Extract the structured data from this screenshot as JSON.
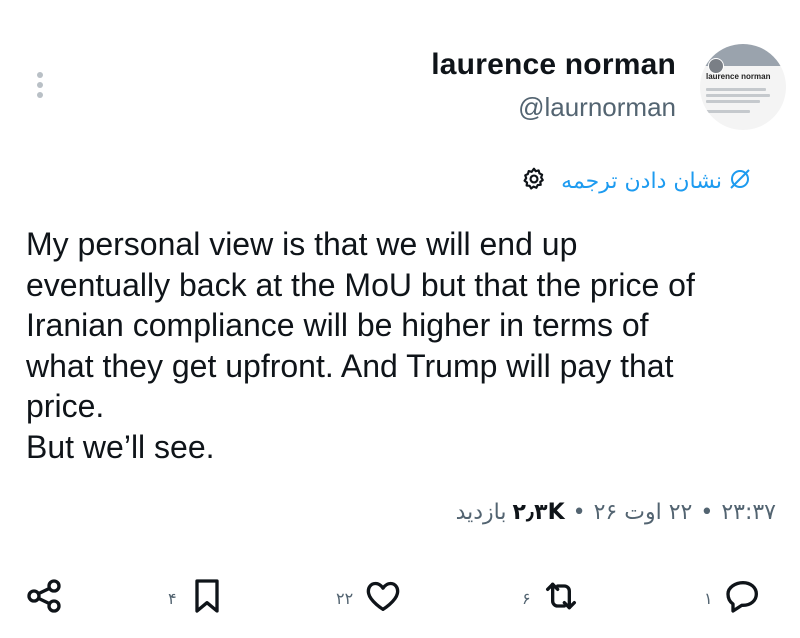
{
  "header": {
    "more_icon": "more-vertical-icon",
    "display_name": "laurence norman",
    "handle": "@laurnorman",
    "profile_card": {
      "name": "laurence norman",
      "bio": "In Europe for The Wall Street Journal, nuclear, EU, European foreign policy"
    }
  },
  "translate": {
    "label": "نشان دادن ترجمه",
    "globe_icon": "globe-slash-icon",
    "settings_icon": "gear-icon"
  },
  "tweet": {
    "lines": [
      "My personal view is that we will end up",
      "eventually back at the MoU but that the price of",
      "Iranian compliance will be higher in terms of",
      "what they get upfront. And Trump will pay that",
      "price.",
      "But we’ll see."
    ]
  },
  "meta": {
    "time": "۲۳:۳۷",
    "date": "۲۲ اوت ۲۶",
    "views_count": "۲٫۳K",
    "views_label": "بازدید",
    "separator": "•"
  },
  "actions": {
    "reply": {
      "icon": "reply-icon",
      "count": "۱"
    },
    "retweet": {
      "icon": "retweet-icon",
      "count": "۶"
    },
    "like": {
      "icon": "heart-icon",
      "count": "۲۲"
    },
    "bookmark": {
      "icon": "bookmark-icon",
      "count": "۴"
    },
    "share": {
      "icon": "share-icon"
    }
  },
  "colors": {
    "accent": "#1d9bf0",
    "text": "#0f1419",
    "secondary": "#536471"
  }
}
